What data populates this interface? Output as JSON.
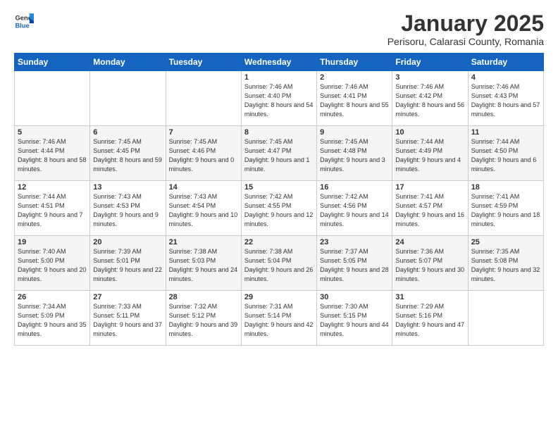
{
  "logo": {
    "general": "General",
    "blue": "Blue"
  },
  "title": "January 2025",
  "subtitle": "Perisoru, Calarasi County, Romania",
  "days_of_week": [
    "Sunday",
    "Monday",
    "Tuesday",
    "Wednesday",
    "Thursday",
    "Friday",
    "Saturday"
  ],
  "weeks": [
    [
      {
        "day": "",
        "sunrise": "",
        "sunset": "",
        "daylight": ""
      },
      {
        "day": "",
        "sunrise": "",
        "sunset": "",
        "daylight": ""
      },
      {
        "day": "",
        "sunrise": "",
        "sunset": "",
        "daylight": ""
      },
      {
        "day": "1",
        "sunrise": "Sunrise: 7:46 AM",
        "sunset": "Sunset: 4:40 PM",
        "daylight": "Daylight: 8 hours and 54 minutes."
      },
      {
        "day": "2",
        "sunrise": "Sunrise: 7:46 AM",
        "sunset": "Sunset: 4:41 PM",
        "daylight": "Daylight: 8 hours and 55 minutes."
      },
      {
        "day": "3",
        "sunrise": "Sunrise: 7:46 AM",
        "sunset": "Sunset: 4:42 PM",
        "daylight": "Daylight: 8 hours and 56 minutes."
      },
      {
        "day": "4",
        "sunrise": "Sunrise: 7:46 AM",
        "sunset": "Sunset: 4:43 PM",
        "daylight": "Daylight: 8 hours and 57 minutes."
      }
    ],
    [
      {
        "day": "5",
        "sunrise": "Sunrise: 7:46 AM",
        "sunset": "Sunset: 4:44 PM",
        "daylight": "Daylight: 8 hours and 58 minutes."
      },
      {
        "day": "6",
        "sunrise": "Sunrise: 7:45 AM",
        "sunset": "Sunset: 4:45 PM",
        "daylight": "Daylight: 8 hours and 59 minutes."
      },
      {
        "day": "7",
        "sunrise": "Sunrise: 7:45 AM",
        "sunset": "Sunset: 4:46 PM",
        "daylight": "Daylight: 9 hours and 0 minutes."
      },
      {
        "day": "8",
        "sunrise": "Sunrise: 7:45 AM",
        "sunset": "Sunset: 4:47 PM",
        "daylight": "Daylight: 9 hours and 1 minute."
      },
      {
        "day": "9",
        "sunrise": "Sunrise: 7:45 AM",
        "sunset": "Sunset: 4:48 PM",
        "daylight": "Daylight: 9 hours and 3 minutes."
      },
      {
        "day": "10",
        "sunrise": "Sunrise: 7:44 AM",
        "sunset": "Sunset: 4:49 PM",
        "daylight": "Daylight: 9 hours and 4 minutes."
      },
      {
        "day": "11",
        "sunrise": "Sunrise: 7:44 AM",
        "sunset": "Sunset: 4:50 PM",
        "daylight": "Daylight: 9 hours and 6 minutes."
      }
    ],
    [
      {
        "day": "12",
        "sunrise": "Sunrise: 7:44 AM",
        "sunset": "Sunset: 4:51 PM",
        "daylight": "Daylight: 9 hours and 7 minutes."
      },
      {
        "day": "13",
        "sunrise": "Sunrise: 7:43 AM",
        "sunset": "Sunset: 4:53 PM",
        "daylight": "Daylight: 9 hours and 9 minutes."
      },
      {
        "day": "14",
        "sunrise": "Sunrise: 7:43 AM",
        "sunset": "Sunset: 4:54 PM",
        "daylight": "Daylight: 9 hours and 10 minutes."
      },
      {
        "day": "15",
        "sunrise": "Sunrise: 7:42 AM",
        "sunset": "Sunset: 4:55 PM",
        "daylight": "Daylight: 9 hours and 12 minutes."
      },
      {
        "day": "16",
        "sunrise": "Sunrise: 7:42 AM",
        "sunset": "Sunset: 4:56 PM",
        "daylight": "Daylight: 9 hours and 14 minutes."
      },
      {
        "day": "17",
        "sunrise": "Sunrise: 7:41 AM",
        "sunset": "Sunset: 4:57 PM",
        "daylight": "Daylight: 9 hours and 16 minutes."
      },
      {
        "day": "18",
        "sunrise": "Sunrise: 7:41 AM",
        "sunset": "Sunset: 4:59 PM",
        "daylight": "Daylight: 9 hours and 18 minutes."
      }
    ],
    [
      {
        "day": "19",
        "sunrise": "Sunrise: 7:40 AM",
        "sunset": "Sunset: 5:00 PM",
        "daylight": "Daylight: 9 hours and 20 minutes."
      },
      {
        "day": "20",
        "sunrise": "Sunrise: 7:39 AM",
        "sunset": "Sunset: 5:01 PM",
        "daylight": "Daylight: 9 hours and 22 minutes."
      },
      {
        "day": "21",
        "sunrise": "Sunrise: 7:38 AM",
        "sunset": "Sunset: 5:03 PM",
        "daylight": "Daylight: 9 hours and 24 minutes."
      },
      {
        "day": "22",
        "sunrise": "Sunrise: 7:38 AM",
        "sunset": "Sunset: 5:04 PM",
        "daylight": "Daylight: 9 hours and 26 minutes."
      },
      {
        "day": "23",
        "sunrise": "Sunrise: 7:37 AM",
        "sunset": "Sunset: 5:05 PM",
        "daylight": "Daylight: 9 hours and 28 minutes."
      },
      {
        "day": "24",
        "sunrise": "Sunrise: 7:36 AM",
        "sunset": "Sunset: 5:07 PM",
        "daylight": "Daylight: 9 hours and 30 minutes."
      },
      {
        "day": "25",
        "sunrise": "Sunrise: 7:35 AM",
        "sunset": "Sunset: 5:08 PM",
        "daylight": "Daylight: 9 hours and 32 minutes."
      }
    ],
    [
      {
        "day": "26",
        "sunrise": "Sunrise: 7:34 AM",
        "sunset": "Sunset: 5:09 PM",
        "daylight": "Daylight: 9 hours and 35 minutes."
      },
      {
        "day": "27",
        "sunrise": "Sunrise: 7:33 AM",
        "sunset": "Sunset: 5:11 PM",
        "daylight": "Daylight: 9 hours and 37 minutes."
      },
      {
        "day": "28",
        "sunrise": "Sunrise: 7:32 AM",
        "sunset": "Sunset: 5:12 PM",
        "daylight": "Daylight: 9 hours and 39 minutes."
      },
      {
        "day": "29",
        "sunrise": "Sunrise: 7:31 AM",
        "sunset": "Sunset: 5:14 PM",
        "daylight": "Daylight: 9 hours and 42 minutes."
      },
      {
        "day": "30",
        "sunrise": "Sunrise: 7:30 AM",
        "sunset": "Sunset: 5:15 PM",
        "daylight": "Daylight: 9 hours and 44 minutes."
      },
      {
        "day": "31",
        "sunrise": "Sunrise: 7:29 AM",
        "sunset": "Sunset: 5:16 PM",
        "daylight": "Daylight: 9 hours and 47 minutes."
      },
      {
        "day": "",
        "sunrise": "",
        "sunset": "",
        "daylight": ""
      }
    ]
  ]
}
